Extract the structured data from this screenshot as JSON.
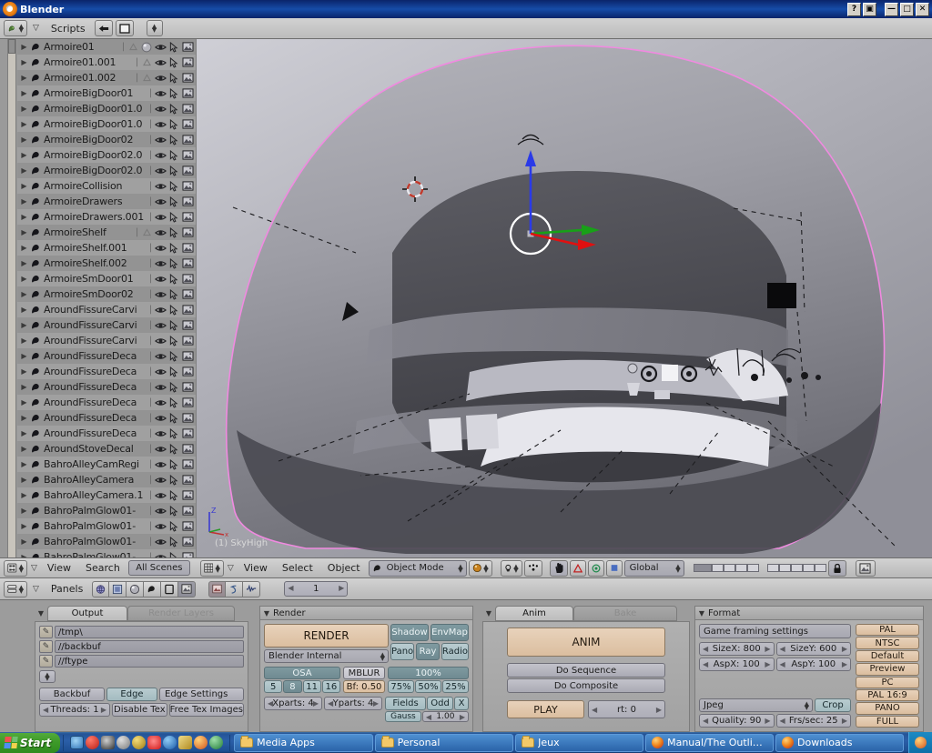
{
  "window": {
    "title": "Blender",
    "icon": "blender-logo-icon",
    "buttons": [
      {
        "name": "help-button",
        "glyph": "?"
      },
      {
        "name": "shade-button",
        "glyph": "▣"
      },
      {
        "name": "minimize-button",
        "glyph": "—"
      },
      {
        "name": "maximize-button",
        "glyph": "□"
      },
      {
        "name": "close-button",
        "glyph": "✕"
      }
    ]
  },
  "scripts_header": {
    "editor_type_icon": "scripts-editor-icon",
    "menu_arrow_icon": "chevron-down-icon",
    "menu_label": "Scripts",
    "back_icon": "arrow-left-icon",
    "screen_icon": "full-window-icon",
    "extra_icon": "updown-selector-icon"
  },
  "outliner": {
    "header": {
      "editor_type_icon": "outliner-editor-icon",
      "menu_arrow_icon": "chevron-down-icon",
      "menus": [
        "View",
        "Search"
      ],
      "display_mode": "All Scenes"
    },
    "items": [
      {
        "name": "Armoire01",
        "extra": [
          "tri-modifier-icon",
          "material-sphere-icon"
        ]
      },
      {
        "name": "Armoire01.001",
        "extra": [
          "tri-modifier-icon"
        ]
      },
      {
        "name": "Armoire01.002",
        "extra": [
          "tri-modifier-icon"
        ]
      },
      {
        "name": "ArmoireBigDoor01",
        "extra": []
      },
      {
        "name": "ArmoireBigDoor01.0",
        "extra": []
      },
      {
        "name": "ArmoireBigDoor01.0",
        "extra": []
      },
      {
        "name": "ArmoireBigDoor02",
        "extra": []
      },
      {
        "name": "ArmoireBigDoor02.0",
        "extra": []
      },
      {
        "name": "ArmoireBigDoor02.0",
        "extra": []
      },
      {
        "name": "ArmoireCollision",
        "extra": []
      },
      {
        "name": "ArmoireDrawers",
        "extra": []
      },
      {
        "name": "ArmoireDrawers.001",
        "extra": []
      },
      {
        "name": "ArmoireShelf",
        "extra": [
          "tri-modifier-icon"
        ]
      },
      {
        "name": "ArmoireShelf.001",
        "extra": []
      },
      {
        "name": "ArmoireShelf.002",
        "extra": []
      },
      {
        "name": "ArmoireSmDoor01",
        "extra": []
      },
      {
        "name": "ArmoireSmDoor02",
        "extra": []
      },
      {
        "name": "AroundFissureCarvi",
        "extra": []
      },
      {
        "name": "AroundFissureCarvi",
        "extra": []
      },
      {
        "name": "AroundFissureCarvi",
        "extra": []
      },
      {
        "name": "AroundFissureDeca",
        "extra": []
      },
      {
        "name": "AroundFissureDeca",
        "extra": []
      },
      {
        "name": "AroundFissureDeca",
        "extra": []
      },
      {
        "name": "AroundFissureDeca",
        "extra": []
      },
      {
        "name": "AroundFissureDeca",
        "extra": []
      },
      {
        "name": "AroundFissureDeca",
        "extra": []
      },
      {
        "name": "AroundStoveDecal",
        "extra": []
      },
      {
        "name": "BahroAlleyCamRegi",
        "extra": []
      },
      {
        "name": "BahroAlleyCamera",
        "extra": []
      },
      {
        "name": "BahroAlleyCamera.1",
        "extra": []
      },
      {
        "name": "BahroPalmGlow01-",
        "extra": []
      },
      {
        "name": "BahroPalmGlow01-",
        "extra": []
      },
      {
        "name": "BahroPalmGlow01-",
        "extra": []
      },
      {
        "name": "BahroPalmGlow01-",
        "extra": []
      }
    ],
    "row_icons": [
      "eye-visibility-icon",
      "cursor-selectable-icon",
      "render-image-icon"
    ]
  },
  "viewport": {
    "scene_label": "(1) SkyHigh",
    "axis_gizmo": {
      "z": "Z",
      "x": "x",
      "y": "y"
    },
    "cursor_icon": "3d-cursor-icon",
    "manipulator_icon": "translate-manipulator-icon"
  },
  "view3d_header": {
    "editor_type_icon": "view3d-editor-icon",
    "menu_arrow_icon": "chevron-down-icon",
    "menus": [
      "View",
      "Select",
      "Object"
    ],
    "mode": "Object Mode",
    "mode_icon": "object-mode-icon",
    "draw_type_icon": "solid-shading-icon",
    "rotate_icons": [
      "lamp-pivot-icon",
      "dots-pivot-icon"
    ],
    "manipulator_buttons": [
      "hand-translate-icon",
      "rotate-triangle-icon",
      "scale-circle-icon",
      "square-icon"
    ],
    "transform_orientation": "Global",
    "layers_lock_icon": "lock-icon",
    "render_icon": "render-preview-icon"
  },
  "buttons_header": {
    "editor_type_icon": "buttons-editor-icon",
    "menu_arrow_icon": "chevron-down-icon",
    "menu_label": "Panels",
    "context_icons": [
      "scene-context-icon",
      "object-context-icon",
      "shading-context-icon",
      "editing-context-icon",
      "script-context-icon",
      "render-context-icon"
    ],
    "sub_icons": [
      "render-buttons-icon",
      "anim-buttons-icon",
      "sound-buttons-icon"
    ],
    "frame": "1",
    "frame_prev_icon": "triangle-left-icon",
    "frame_next_icon": "triangle-right-icon"
  },
  "panels": {
    "output": {
      "tabs": [
        {
          "label": "Output",
          "active": true
        },
        {
          "label": "Render Layers",
          "active": false
        }
      ],
      "collapse_icon": "triangle-down-icon",
      "paths": [
        "/tmp\\",
        "//backbuf",
        "//ftype"
      ],
      "path_icon": "file-browse-icon",
      "selector_icon": "updown-selector-icon",
      "buttons_row1": [
        "Backbuf",
        "Edge",
        "Edge Settings"
      ],
      "buttons_row2": [
        "Threads: 1",
        "Disable Tex",
        "Free Tex Images"
      ],
      "active_toggle": "Edge"
    },
    "render": {
      "title": "Render",
      "collapse_icon": "triangle-down-icon",
      "render_button": "RENDER",
      "engine": "Blender Internal",
      "toggles_top": [
        "Shadow",
        "EnvMap"
      ],
      "toggles_mid": [
        "Pano",
        "Ray",
        "Radio"
      ],
      "toggles_active": [
        "Shadow",
        "EnvMap",
        "Ray"
      ],
      "osa_label": "OSA",
      "osa_values": [
        "5",
        "8",
        "11",
        "16"
      ],
      "osa_selected": "8",
      "mblur_label": "MBLUR",
      "mblur_value": "Bf: 0.50",
      "size_label": "100%",
      "size_values": [
        "75%",
        "50%",
        "25%"
      ],
      "xparts": "Xparts: 4",
      "yparts": "Yparts: 4",
      "fields_label": "Fields",
      "odd_label": "Odd",
      "x_label": "X",
      "gauss_label": "Gauss",
      "gauss_value": "1.00"
    },
    "anim": {
      "tabs": [
        {
          "label": "Anim",
          "active": true
        },
        {
          "label": "Bake",
          "active": false
        }
      ],
      "collapse_icon": "triangle-down-icon",
      "anim_button": "ANIM",
      "do_sequence": "Do Sequence",
      "do_composite": "Do Composite",
      "play_button": "PLAY",
      "rt_value": "rt: 0"
    },
    "format": {
      "title": "Format",
      "collapse_icon": "triangle-down-icon",
      "game_framing": "Game framing settings",
      "size_x": "SizeX: 800",
      "size_y": "SizeY: 600",
      "asp_x": "AspX: 100",
      "asp_y": "AspY: 100",
      "file_format": "Jpeg",
      "crop": "Crop",
      "quality": "Quality: 90",
      "fps": "Frs/sec: 25",
      "presets": [
        "PAL",
        "NTSC",
        "Default",
        "Preview",
        "PC",
        "PAL 16:9",
        "PANO",
        "FULL"
      ]
    }
  },
  "taskbar": {
    "start_label": "Start",
    "quick_launch": [
      {
        "name": "quicklaunch-icon-1",
        "color": "#3b83c8"
      },
      {
        "name": "quicklaunch-icon-2",
        "color": "#cc2222"
      },
      {
        "name": "quicklaunch-icon-3",
        "color": "#404040"
      },
      {
        "name": "quicklaunch-icon-4",
        "color": "#8a8a8a"
      },
      {
        "name": "quicklaunch-icon-5",
        "color": "#c8a018"
      },
      {
        "name": "quicklaunch-icon-6",
        "color": "#e02020"
      },
      {
        "name": "quicklaunch-icon-7",
        "color": "#2a7ad0"
      },
      {
        "name": "quicklaunch-icon-8",
        "color": "#d0b03a"
      },
      {
        "name": "quicklaunch-icon-9",
        "color": "#e07818"
      },
      {
        "name": "quicklaunch-icon-10",
        "color": "#2a9a4a"
      }
    ],
    "tasks": [
      {
        "label": "Media Apps",
        "icon": "folder-icon"
      },
      {
        "label": "Personal",
        "icon": "folder-icon"
      },
      {
        "label": "Jeux",
        "icon": "folder-icon"
      },
      {
        "label": "Manual/The Outliner - Bl...",
        "icon": "firefox-icon"
      },
      {
        "label": "Downloads",
        "icon": "firefox-icon"
      }
    ]
  },
  "colors": {
    "title_blue": "#0a246a",
    "blender_gray": "#b8b8b8",
    "outliner_gray": "#9a9a9a",
    "panel_gray": "#a8a8a8",
    "teal_toggle": "#7f9aa0",
    "peach_button": "#e0c2a2",
    "taskbar_blue": "#245497",
    "start_green": "#3d9a29",
    "selection_pink": "#f08ae0"
  }
}
